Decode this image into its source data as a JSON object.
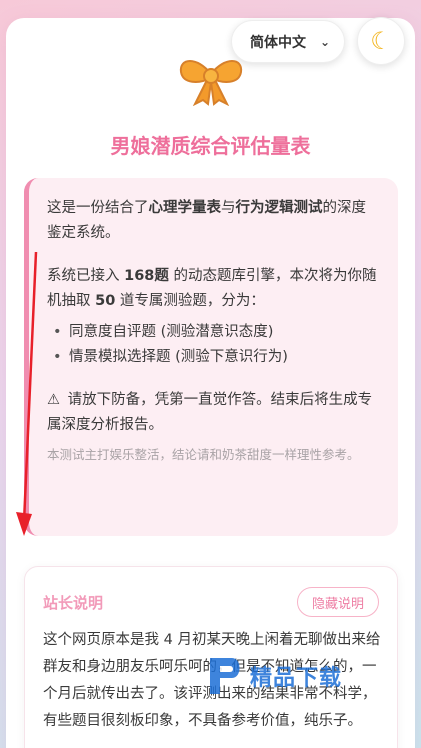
{
  "header": {
    "language": "简体中文",
    "language_chevron": "chevron-down-icon",
    "theme_icon": "moon-icon"
  },
  "page": {
    "title": "男娘潜质综合评估量表"
  },
  "intro": {
    "p1_pre": "这是一份结合了",
    "p1_b1": "心理学量表",
    "p1_mid": "与",
    "p1_b2": "行为逻辑测试",
    "p1_post": "的深度鉴定系统。",
    "p2_pre": "系统已接入 ",
    "p2_b1": "168题",
    "p2_mid": " 的动态题库引擎，本次将为你随机抽取 ",
    "p2_b2": "50",
    "p2_post": " 道专属测验题，分为：",
    "items": [
      "同意度自评题 (测验潜意识态度)",
      "情景模拟选择题 (测验下意识行为)"
    ],
    "warning": "请放下防备，凭第一直觉作答。结束后将生成专属深度分析报告。",
    "note": "本测试主打娱乐整活，结论请和奶茶甜度一样理性参考。"
  },
  "owner": {
    "title": "站长说明",
    "hide_button": "隐藏说明",
    "body": "这个网页原本是我 4 月初某天晚上闲着无聊做出来给群友和身边朋友乐呵乐呵的，但是不知道怎么的，一个月后就传出去了。该评测出来的结果非常不科学，有些题目很刻板印象，不具备参考价值，纯乐子。"
  },
  "watermark": {
    "text": "精品下载"
  },
  "colors": {
    "accent": "#ee6f9b",
    "intro_bg": "#fdeef3",
    "intro_border": "#f08db0",
    "arrow": "#e8202a"
  }
}
